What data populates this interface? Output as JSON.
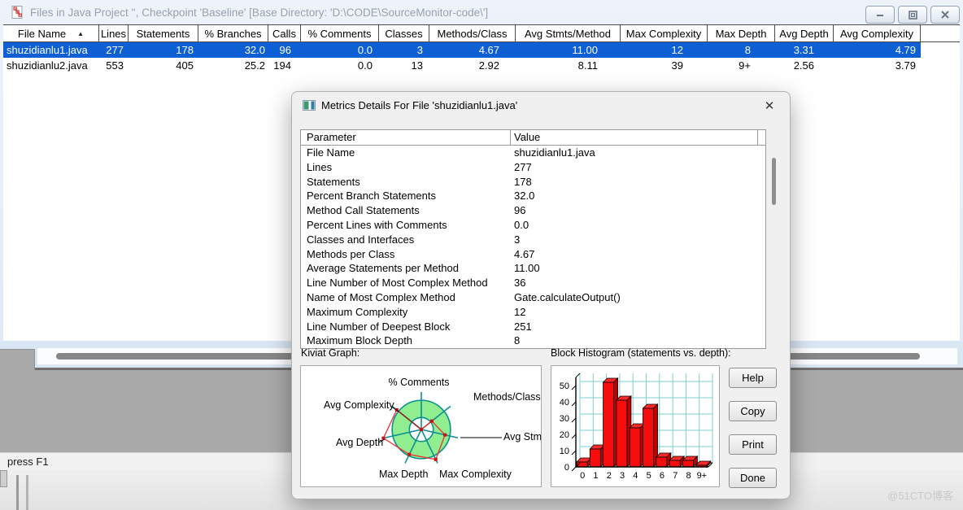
{
  "window": {
    "title": "Files in Java Project '', Checkpoint 'Baseline'  [Base Directory: 'D:\\CODE\\SourceMonitor-code\\']"
  },
  "file_table": {
    "columns": [
      "File Name",
      "Lines",
      "Statements",
      "% Branches",
      "Calls",
      "% Comments",
      "Classes",
      "Methods/Class",
      "Avg Stmts/Method",
      "Max Complexity",
      "Max Depth",
      "Avg Depth",
      "Avg Complexity"
    ],
    "sort_column": "File Name",
    "sort_indicator": "▲",
    "rows": [
      {
        "selected": true,
        "cells": [
          "shuzidianlu1.java",
          "277",
          "178",
          "32.0",
          "96",
          "0.0",
          "3",
          "4.67",
          "11.00",
          "12",
          "8",
          "3.31",
          "4.79"
        ]
      },
      {
        "selected": false,
        "cells": [
          "shuzidianlu2.java",
          "553",
          "405",
          "25.2",
          "194",
          "0.0",
          "13",
          "2.92",
          "8.11",
          "39",
          "9+",
          "2.56",
          "3.79"
        ]
      }
    ]
  },
  "status_bar": {
    "text": "press F1"
  },
  "dialog": {
    "title": "Metrics Details For File 'shuzidianlu1.java'",
    "close_glyph": "✕",
    "param_table": {
      "headers": [
        "Parameter",
        "Value"
      ],
      "rows": [
        [
          "File Name",
          "shuzidianlu1.java"
        ],
        [
          "Lines",
          "277"
        ],
        [
          "Statements",
          "178"
        ],
        [
          "Percent Branch Statements",
          "32.0"
        ],
        [
          "Method Call Statements",
          "96"
        ],
        [
          "Percent Lines with Comments",
          "0.0"
        ],
        [
          "Classes and Interfaces",
          "3"
        ],
        [
          "Methods per Class",
          "4.67"
        ],
        [
          "Average Statements per Method",
          "11.00"
        ],
        [
          "Line Number of Most Complex Method",
          "36"
        ],
        [
          "Name of Most Complex Method",
          "Gate.calculateOutput()"
        ],
        [
          "Maximum Complexity",
          "12"
        ],
        [
          "Line Number of Deepest Block",
          "251"
        ],
        [
          "Maximum Block Depth",
          "8"
        ]
      ]
    },
    "kiviat_label": "Kiviat Graph:",
    "histogram_label": "Block Histogram (statements vs. depth):",
    "buttons": [
      "Help",
      "Copy",
      "Print",
      "Done"
    ]
  },
  "watermark": "@51CTO博客",
  "colors": {
    "selection_blue": "#0d5fd3",
    "kiviat_band_green": "#90ee90",
    "kiviat_axis_teal": "#0a9090",
    "series_red": "#f01414",
    "histogram_grid_teal": "#7fcfcf",
    "bar_red": "#f50d0d"
  },
  "chart_data": [
    {
      "type": "radar",
      "title": "Kiviat Graph",
      "axes": [
        "% Comments",
        "Methods/Class",
        "Avg Stmts/Method",
        "Max Complexity",
        "Max Depth",
        "Avg Depth",
        "Avg Complexity"
      ],
      "values_fraction_of_axis": [
        0,
        0.36,
        0.65,
        0.89,
        0.74,
        1.04,
        0.84
      ],
      "normal_band_fraction": {
        "inner": 0.32,
        "outer": 0.78
      },
      "grid": false,
      "legend_position": "none"
    },
    {
      "type": "bar",
      "title": "Block Histogram (statements vs. depth)",
      "categories": [
        "0",
        "1",
        "2",
        "3",
        "4",
        "5",
        "6",
        "7",
        "8",
        "9+"
      ],
      "values": [
        3,
        11,
        52,
        41,
        24,
        36,
        6,
        4,
        4,
        1
      ],
      "xlabel": "depth",
      "ylabel": "statements",
      "yticks": [
        0,
        10,
        20,
        30,
        40,
        50
      ],
      "ylim": [
        0,
        55
      ],
      "grid": true,
      "style": "3d-red-bars"
    }
  ]
}
